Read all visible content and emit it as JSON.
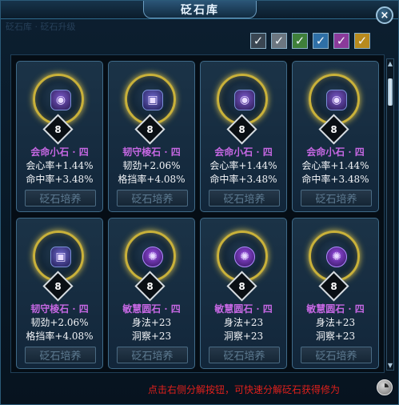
{
  "window": {
    "title": "砭石库",
    "ghost_text": "砭石库 · 砭石升级"
  },
  "filters": [
    {
      "color": "#3a4652"
    },
    {
      "color": "#6c7680"
    },
    {
      "color": "#3f7f3a"
    },
    {
      "color": "#2e6fa6"
    },
    {
      "color": "#8a3a9a"
    },
    {
      "color": "#b88a1d"
    }
  ],
  "checkmark": "✓",
  "close": "×",
  "cards": [
    {
      "icon": "shield",
      "glyph": "◉",
      "level": "8",
      "name": "会命小石 · 四",
      "stat1": "会心率+1.44%",
      "stat2": "命中率+3.48%",
      "button": "砭石培养"
    },
    {
      "icon": "cube",
      "glyph": "▣",
      "level": "8",
      "name": "韧守棱石 · 四",
      "stat1": "韧劲+2.06%",
      "stat2": "格挡率+4.08%",
      "button": "砭石培养"
    },
    {
      "icon": "shield",
      "glyph": "◉",
      "level": "8",
      "name": "会命小石 · 四",
      "stat1": "会心率+1.44%",
      "stat2": "命中率+3.48%",
      "button": "砭石培养"
    },
    {
      "icon": "shield",
      "glyph": "◉",
      "level": "8",
      "name": "会命小石 · 四",
      "stat1": "会心率+1.44%",
      "stat2": "命中率+3.48%",
      "button": "砭石培养"
    },
    {
      "icon": "cube",
      "glyph": "▣",
      "level": "8",
      "name": "韧守棱石 · 四",
      "stat1": "韧劲+2.06%",
      "stat2": "格挡率+4.08%",
      "button": "砭石培养"
    },
    {
      "icon": "tree",
      "glyph": "✺",
      "level": "8",
      "name": "敏慧圆石 · 四",
      "stat1": "身法+23",
      "stat2": "洞察+23",
      "button": "砭石培养"
    },
    {
      "icon": "tree",
      "glyph": "✺",
      "level": "8",
      "name": "敏慧圆石 · 四",
      "stat1": "身法+23",
      "stat2": "洞察+23",
      "button": "砭石培养"
    },
    {
      "icon": "tree",
      "glyph": "✺",
      "level": "8",
      "name": "敏慧圆石 · 四",
      "stat1": "身法+23",
      "stat2": "洞察+23",
      "button": "砭石培养"
    }
  ],
  "footer": {
    "hint": "点击右侧分解按钮，可快速分解砭石获得修为"
  },
  "scrollbar": {
    "up": "▲",
    "down": "▼"
  }
}
